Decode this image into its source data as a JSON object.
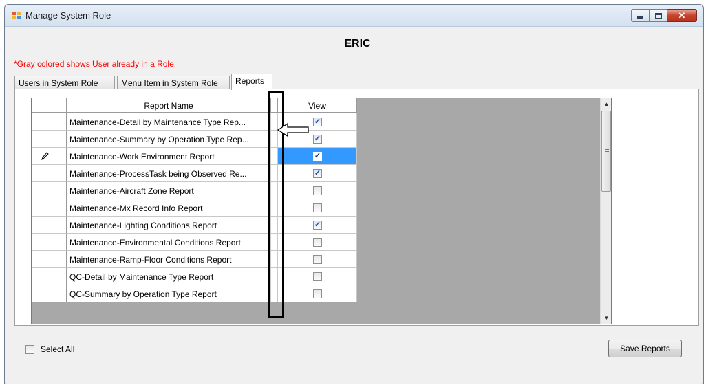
{
  "window": {
    "title": "Manage System Role",
    "close_glyph": "✕"
  },
  "role_name": "ERIC",
  "note": "*Gray colored shows User already in a Role.",
  "tabs": [
    {
      "label": "Users in System Role",
      "active": false
    },
    {
      "label": "Menu Item in System Role",
      "active": false
    },
    {
      "label": "Reports",
      "active": true
    }
  ],
  "grid": {
    "columns": {
      "report_name": "Report Name",
      "view": "View"
    },
    "rows": [
      {
        "name": "Maintenance-Detail by Maintenance Type Rep...",
        "view": true,
        "selected": false,
        "editing": false
      },
      {
        "name": "Maintenance-Summary by Operation Type Rep...",
        "view": true,
        "selected": false,
        "editing": false
      },
      {
        "name": "Maintenance-Work Environment Report",
        "view": true,
        "selected": true,
        "editing": true
      },
      {
        "name": "Maintenance-ProcessTask being Observed Re...",
        "view": true,
        "selected": false,
        "editing": false
      },
      {
        "name": "Maintenance-Aircraft Zone Report",
        "view": false,
        "selected": false,
        "editing": false
      },
      {
        "name": "Maintenance-Mx Record Info Report",
        "view": false,
        "selected": false,
        "editing": false
      },
      {
        "name": "Maintenance-Lighting Conditions Report",
        "view": true,
        "selected": false,
        "editing": false
      },
      {
        "name": "Maintenance-Environmental Conditions Report",
        "view": false,
        "selected": false,
        "editing": false
      },
      {
        "name": "Maintenance-Ramp-Floor Conditions Report",
        "view": false,
        "selected": false,
        "editing": false
      },
      {
        "name": "QC-Detail by Maintenance Type Report",
        "view": false,
        "selected": false,
        "editing": false
      },
      {
        "name": "QC-Summary by Operation Type Report",
        "view": false,
        "selected": false,
        "editing": false
      }
    ],
    "check_glyph": "✓",
    "scroll_up_glyph": "▲",
    "scroll_down_glyph": "▼"
  },
  "select_all": {
    "label": "Select All",
    "checked": false
  },
  "save_button": {
    "label": "Save Reports"
  },
  "colors": {
    "selection": "#3399ff",
    "note_text": "#ff0000",
    "grid_background": "#a8a8a8"
  }
}
